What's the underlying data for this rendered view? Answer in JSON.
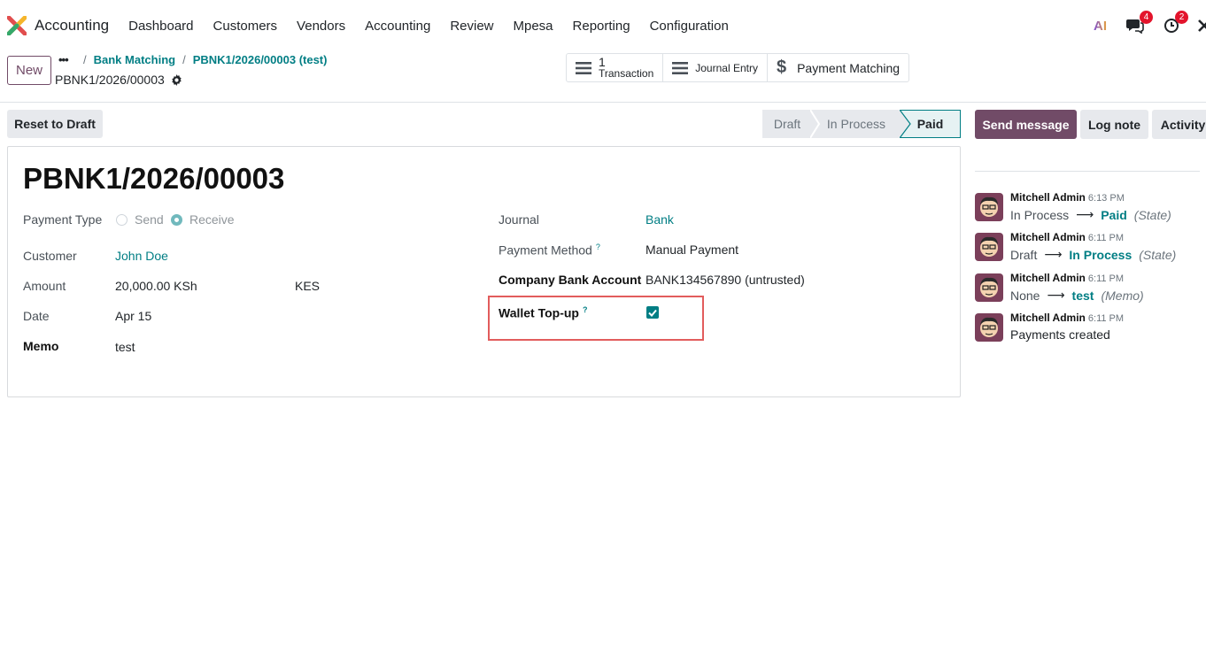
{
  "navbar": {
    "app_name": "Accounting",
    "menu": [
      "Dashboard",
      "Customers",
      "Vendors",
      "Accounting",
      "Review",
      "Mpesa",
      "Reporting",
      "Configuration"
    ],
    "ai_label": "AI",
    "messages_badge": "4",
    "activities_badge": "2"
  },
  "control": {
    "new_label": "New",
    "breadcrumbs": [
      "Bank Matching",
      "PBNK1/2026/00003 (test)"
    ],
    "record_name": "PBNK1/2026/00003",
    "smart_buttons": {
      "transaction_count": "1",
      "transaction_label": "Transaction",
      "journal_entry_label": "Journal Entry",
      "payment_matching_label": "Payment Matching"
    }
  },
  "status": {
    "reset_label": "Reset to Draft",
    "stages": [
      "Draft",
      "In Process",
      "Paid"
    ],
    "current": "Paid"
  },
  "form": {
    "title": "PBNK1/2026/00003",
    "payment_type_label": "Payment Type",
    "payment_type_options": [
      "Send",
      "Receive"
    ],
    "payment_type_selected": "Receive",
    "customer_label": "Customer",
    "customer_value": "John Doe",
    "amount_label": "Amount",
    "amount_value": "20,000.00 KSh",
    "currency_value": "KES",
    "date_label": "Date",
    "date_value": "Apr 15",
    "memo_label": "Memo",
    "memo_value": "test",
    "journal_label": "Journal",
    "journal_value": "Bank",
    "payment_method_label": "Payment Method",
    "payment_method_value": "Manual Payment",
    "company_bank_label": "Company Bank Account",
    "company_bank_value": "BANK134567890 (untrusted)",
    "wallet_topup_label": "Wallet Top-up",
    "wallet_topup_checked": true,
    "help_mark": "?"
  },
  "chatter": {
    "send_message_label": "Send message",
    "log_note_label": "Log note",
    "activity_label": "Activity",
    "messages": [
      {
        "author": "Mitchell Admin",
        "time": "6:13 PM",
        "old": "In Process",
        "new": "Paid",
        "field": "(State)"
      },
      {
        "author": "Mitchell Admin",
        "time": "6:11 PM",
        "old": "Draft",
        "new": "In Process",
        "field": "(State)"
      },
      {
        "author": "Mitchell Admin",
        "time": "6:11 PM",
        "old": "None",
        "new": "test",
        "field": "(Memo)"
      },
      {
        "author": "Mitchell Admin",
        "time": "6:11 PM",
        "body": "Payments created"
      }
    ]
  }
}
